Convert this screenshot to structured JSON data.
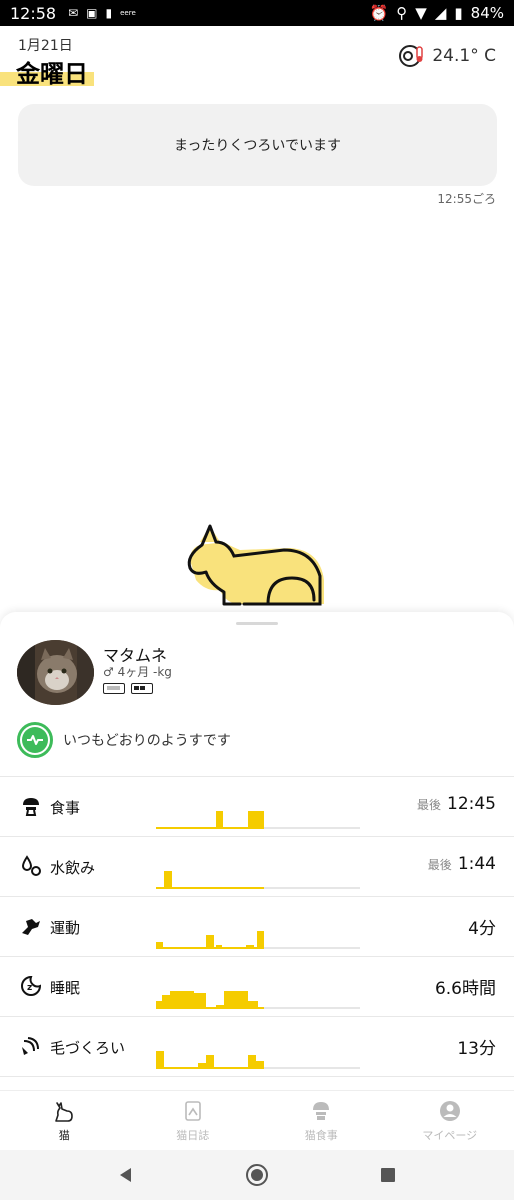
{
  "statusbar": {
    "time": "12:58",
    "notifications": [
      "mail-icon",
      "car-icon",
      "sim-icon"
    ],
    "small_text": "eere",
    "battery": "84%"
  },
  "header": {
    "date_small": "1月21日",
    "weekday": "金曜日",
    "temperature": "24.1° C"
  },
  "status": {
    "message": "まったりくつろいでいます",
    "time": "12:55ごろ"
  },
  "pet": {
    "name": "マタムネ",
    "info": "♂ 4ヶ月 -kg",
    "health": "いつもどおりのようすです"
  },
  "metrics": [
    {
      "label": "食事",
      "hint": "最後",
      "value": "12:45",
      "icon": "food-bowl-icon"
    },
    {
      "label": "水飲み",
      "hint": "最後",
      "value": "1:44",
      "icon": "water-drop-icon"
    },
    {
      "label": "運動",
      "hint": "",
      "value": "4分",
      "icon": "running-cat-icon"
    },
    {
      "label": "睡眠",
      "hint": "",
      "value": "6.6時間",
      "icon": "sleep-icon"
    },
    {
      "label": "毛づくろい",
      "hint": "",
      "value": "13分",
      "icon": "grooming-icon"
    }
  ],
  "nav": {
    "items": [
      {
        "label": "猫",
        "icon": "cat-icon",
        "active": true
      },
      {
        "label": "猫日誌",
        "icon": "diary-icon",
        "active": false
      },
      {
        "label": "猫食事",
        "icon": "food-icon",
        "active": false
      },
      {
        "label": "マイページ",
        "icon": "profile-icon",
        "active": false
      }
    ]
  },
  "colors": {
    "accent": "#f5cc00",
    "highlight": "#f9e27c",
    "health_green": "#3dbb5a"
  }
}
